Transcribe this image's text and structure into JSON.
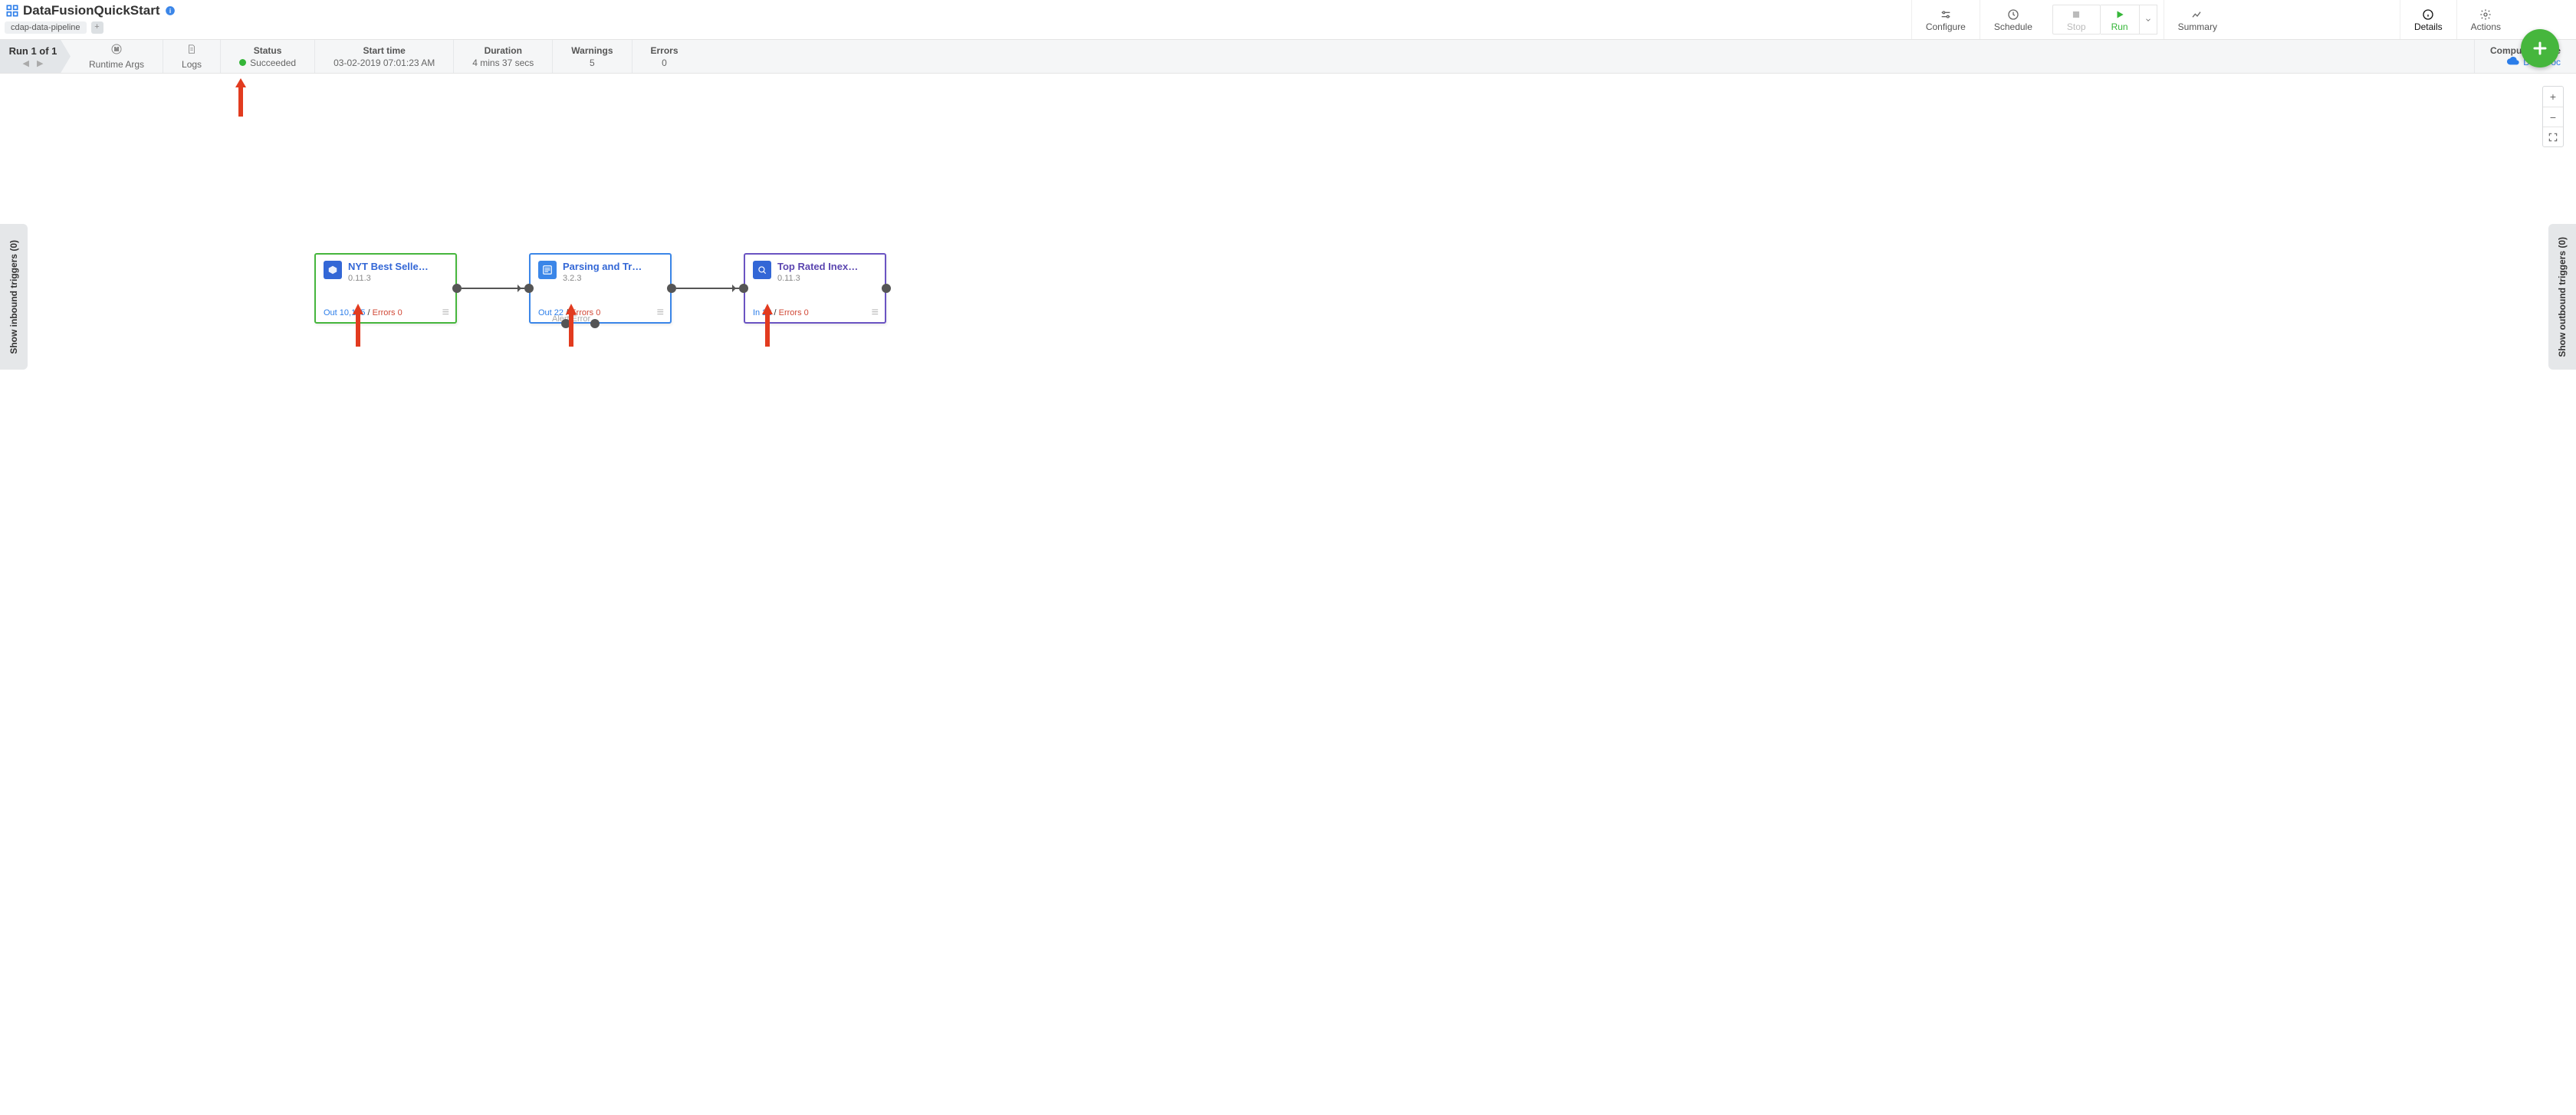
{
  "header": {
    "app_name": "DataFusionQuickStart",
    "tag": "cdap-data-pipeline",
    "buttons": {
      "configure": "Configure",
      "schedule": "Schedule",
      "stop": "Stop",
      "run": "Run",
      "summary": "Summary",
      "details": "Details",
      "actions": "Actions"
    }
  },
  "runbar": {
    "run_label": "Run 1 of 1",
    "runtime_args": "Runtime Args",
    "logs": "Logs",
    "status_hdr": "Status",
    "status_val": "Succeeded",
    "start_hdr": "Start time",
    "start_val": "03-02-2019 07:01:23 AM",
    "dur_hdr": "Duration",
    "dur_val": "4 mins 37 secs",
    "warn_hdr": "Warnings",
    "warn_val": "5",
    "err_hdr": "Errors",
    "err_val": "0",
    "compute_hdr": "Compute profile",
    "compute_val": "Dataproc"
  },
  "sidetabs": {
    "inbound": "Show inbound triggers (0)",
    "outbound": "Show outbound triggers (0)"
  },
  "nodes": {
    "n1": {
      "title": "NYT Best Selle…",
      "version": "0.11.3",
      "stat_out": "Out 10,195",
      "stat_div": " / ",
      "stat_err": "Errors 0"
    },
    "n2": {
      "title": "Parsing and Tr…",
      "version": "3.2.3",
      "stat_out": "Out 22",
      "stat_div": " / ",
      "stat_err": "Errors 0",
      "bottom_label": "Alert    Error"
    },
    "n3": {
      "title": "Top Rated Inex…",
      "version": "0.11.3",
      "stat_out": "In 22",
      "stat_div": " / ",
      "stat_err": "Errors 0"
    }
  }
}
